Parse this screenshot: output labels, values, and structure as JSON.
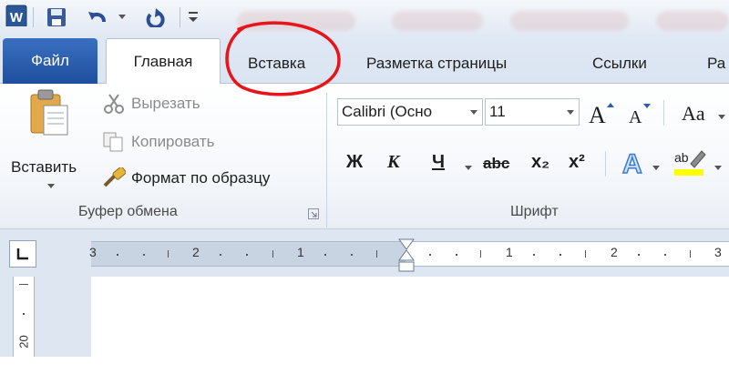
{
  "tabs": {
    "file": "Файл",
    "home": "Главная",
    "insert": "Вставка",
    "page_layout": "Разметка страницы",
    "references": "Ссылки",
    "cut_off": "Ра"
  },
  "clipboard": {
    "paste": "Вставить",
    "cut": "Вырезать",
    "copy": "Копировать",
    "format_painter": "Формат по образцу",
    "group_label": "Буфер обмена"
  },
  "font": {
    "font_name": "Calibri (Осно",
    "font_size": "11",
    "bold": "Ж",
    "italic": "К",
    "underline": "Ч",
    "strikethrough": "abc",
    "subscript": "x₂",
    "superscript": "x²",
    "change_case": "Aa",
    "group_label": "Шрифт"
  },
  "ruler": {
    "numbers": [
      "3",
      "2",
      "1",
      "1",
      "2",
      "3"
    ],
    "vertical": "20"
  },
  "colors": {
    "file_tab": "#2a5caa",
    "annotation": "#e8141c"
  }
}
